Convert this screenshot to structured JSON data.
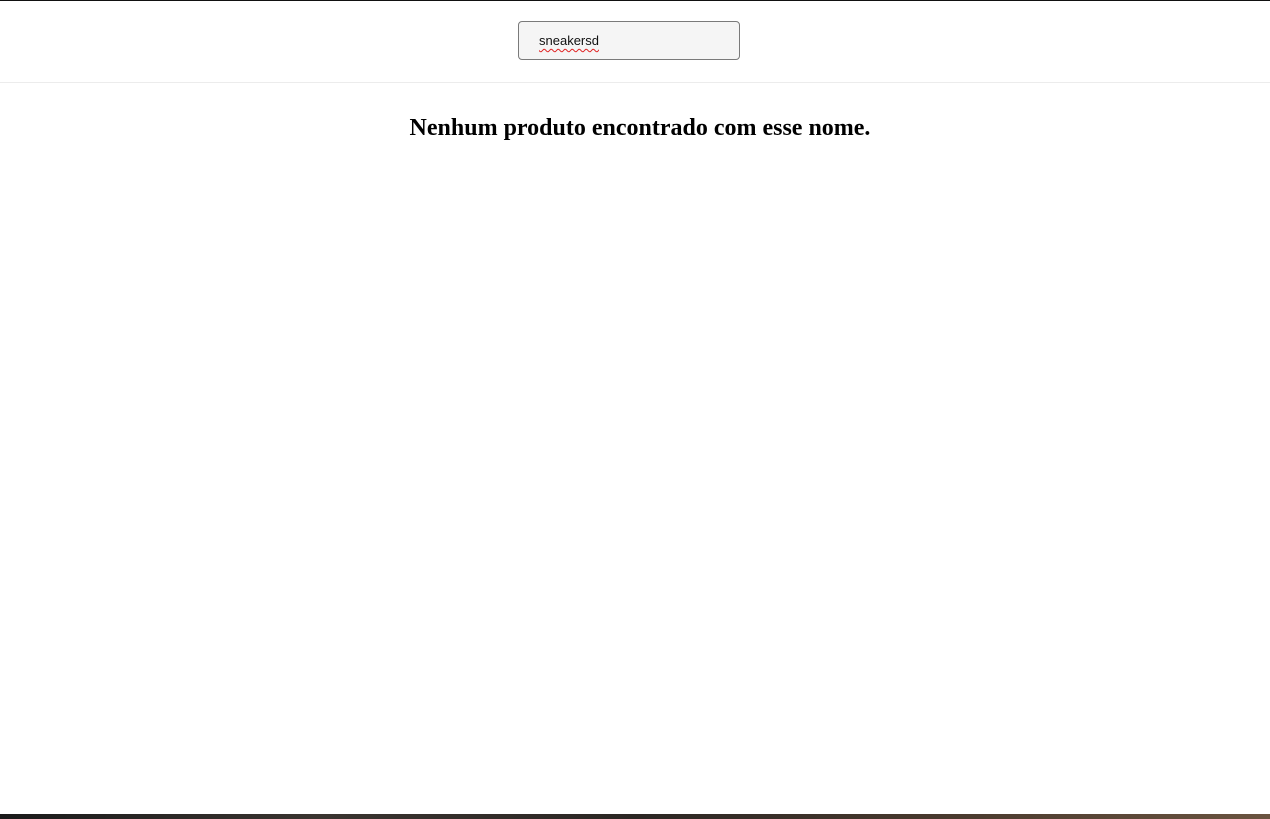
{
  "search": {
    "value": "sneakersd"
  },
  "results": {
    "empty_message": "Nenhum produto encontrado com esse nome."
  }
}
